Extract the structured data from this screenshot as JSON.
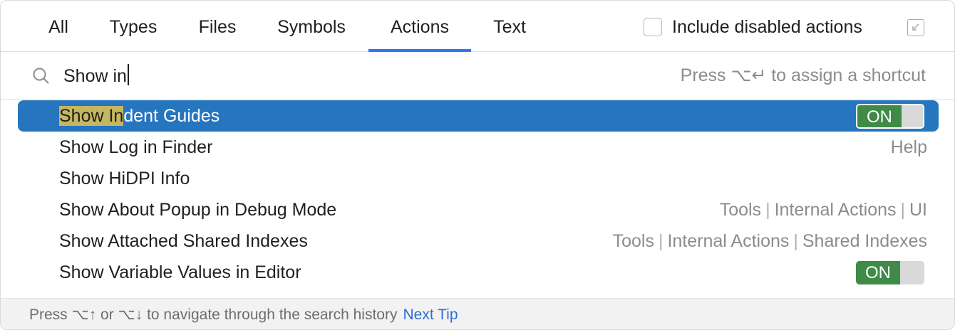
{
  "tabs": [
    {
      "label": "All"
    },
    {
      "label": "Types"
    },
    {
      "label": "Files"
    },
    {
      "label": "Symbols"
    },
    {
      "label": "Actions"
    },
    {
      "label": "Text"
    }
  ],
  "active_tab": "Actions",
  "include_disabled": {
    "label": "Include disabled actions",
    "checked": false
  },
  "search": {
    "value_match": "Show in",
    "shortcut_hint": "Press ⌥↵ to assign a shortcut"
  },
  "results": [
    {
      "match": "Show In",
      "rest": "dent Guides",
      "toggle": "ON",
      "selected": true
    },
    {
      "label": "Show Log in Finder",
      "right": [
        "Help"
      ]
    },
    {
      "label": "Show HiDPI Info",
      "right": []
    },
    {
      "label": "Show About Popup in Debug Mode",
      "right": [
        "Tools",
        "Internal Actions",
        "UI"
      ]
    },
    {
      "label": "Show Attached Shared Indexes",
      "right": [
        "Tools",
        "Internal Actions",
        "Shared Indexes"
      ]
    },
    {
      "label": "Show Variable Values in Editor",
      "toggle": "ON"
    }
  ],
  "footer": {
    "hint": "Press ⌥↑ or ⌥↓ to navigate through the search history",
    "link": "Next Tip"
  },
  "colors": {
    "accent": "#3574f0",
    "selection": "#2675bf",
    "match_highlight": "#c4b760",
    "toggle_on": "#3f8a46",
    "link": "#2e6ed6"
  }
}
